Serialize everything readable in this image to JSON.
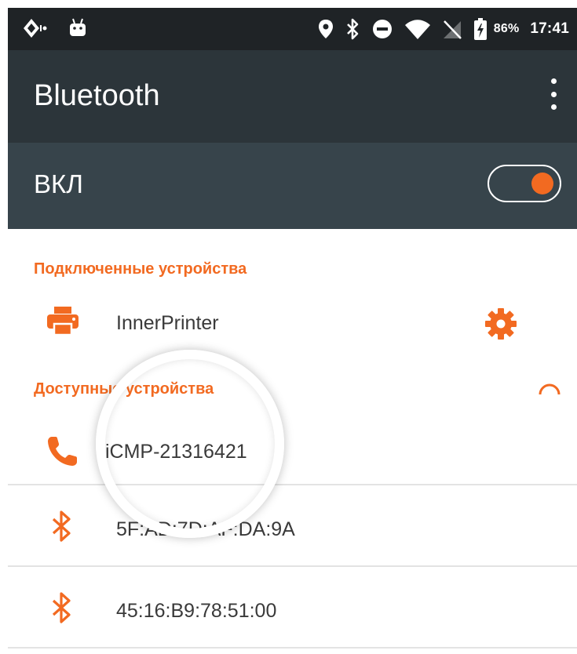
{
  "status_bar": {
    "battery_percent": "86%",
    "time": "17:41",
    "icons": [
      "nfc-icon",
      "android-icon",
      "location-icon",
      "bluetooth-icon",
      "do-not-disturb-icon",
      "wifi-icon",
      "no-signal-icon",
      "battery-charging-icon"
    ]
  },
  "app_bar": {
    "title": "Bluetooth",
    "menu_icon": "more-vert-icon"
  },
  "toggle": {
    "label": "ВКЛ",
    "state": "on",
    "accent": "#f26a21"
  },
  "paired": {
    "header": "Подключенные устройства",
    "devices": [
      {
        "name": "InnerPrinter",
        "icon": "printer-icon",
        "action_icon": "gear-icon"
      }
    ]
  },
  "available": {
    "header": "Доступные устройства",
    "scanning_icon": "spinner-icon",
    "devices": [
      {
        "name": "iCMP-21316421",
        "icon": "phone-icon"
      },
      {
        "name": "5F:AD:7D:AF:DA:9A",
        "icon": "bluetooth-icon"
      },
      {
        "name": "45:16:B9:78:51:00",
        "icon": "bluetooth-icon"
      }
    ]
  },
  "colors": {
    "accent": "#f26a21",
    "status_bar": "#1f2326",
    "app_bar": "#2c353a",
    "toggle_bar": "#37444b"
  }
}
